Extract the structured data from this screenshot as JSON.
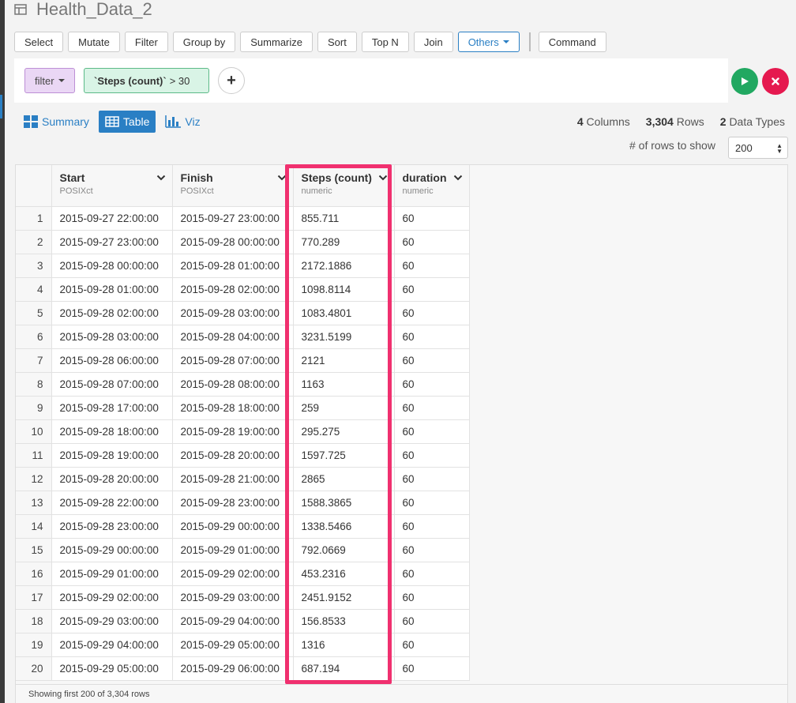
{
  "header": {
    "title": "Health_Data_2"
  },
  "toolbar": {
    "buttons": [
      "Select",
      "Mutate",
      "Filter",
      "Group by",
      "Summarize",
      "Sort",
      "Top N",
      "Join"
    ],
    "others_label": "Others",
    "command_label": "Command"
  },
  "filter": {
    "type_label": "filter",
    "expr_field": "`Steps (count)`",
    "expr_rest": "> 30"
  },
  "views": {
    "summary": "Summary",
    "table": "Table",
    "viz": "Viz"
  },
  "stats": {
    "columns_count": "4",
    "columns_label": "Columns",
    "rows_count": "3,304",
    "rows_label": "Rows",
    "types_count": "2",
    "types_label": "Data Types"
  },
  "rows_to_show": {
    "label": "# of rows to show",
    "value": "200"
  },
  "table": {
    "columns": [
      {
        "name": "Start",
        "type": "POSIXct"
      },
      {
        "name": "Finish",
        "type": "POSIXct"
      },
      {
        "name": "Steps (count)",
        "type": "numeric"
      },
      {
        "name": "duration",
        "type": "numeric"
      }
    ],
    "rows": [
      [
        "1",
        "2015-09-27 22:00:00",
        "2015-09-27 23:00:00",
        "855.711",
        "60"
      ],
      [
        "2",
        "2015-09-27 23:00:00",
        "2015-09-28 00:00:00",
        "770.289",
        "60"
      ],
      [
        "3",
        "2015-09-28 00:00:00",
        "2015-09-28 01:00:00",
        "2172.1886",
        "60"
      ],
      [
        "4",
        "2015-09-28 01:00:00",
        "2015-09-28 02:00:00",
        "1098.8114",
        "60"
      ],
      [
        "5",
        "2015-09-28 02:00:00",
        "2015-09-28 03:00:00",
        "1083.4801",
        "60"
      ],
      [
        "6",
        "2015-09-28 03:00:00",
        "2015-09-28 04:00:00",
        "3231.5199",
        "60"
      ],
      [
        "7",
        "2015-09-28 06:00:00",
        "2015-09-28 07:00:00",
        "2121",
        "60"
      ],
      [
        "8",
        "2015-09-28 07:00:00",
        "2015-09-28 08:00:00",
        "1163",
        "60"
      ],
      [
        "9",
        "2015-09-28 17:00:00",
        "2015-09-28 18:00:00",
        "259",
        "60"
      ],
      [
        "10",
        "2015-09-28 18:00:00",
        "2015-09-28 19:00:00",
        "295.275",
        "60"
      ],
      [
        "11",
        "2015-09-28 19:00:00",
        "2015-09-28 20:00:00",
        "1597.725",
        "60"
      ],
      [
        "12",
        "2015-09-28 20:00:00",
        "2015-09-28 21:00:00",
        "2865",
        "60"
      ],
      [
        "13",
        "2015-09-28 22:00:00",
        "2015-09-28 23:00:00",
        "1588.3865",
        "60"
      ],
      [
        "14",
        "2015-09-28 23:00:00",
        "2015-09-29 00:00:00",
        "1338.5466",
        "60"
      ],
      [
        "15",
        "2015-09-29 00:00:00",
        "2015-09-29 01:00:00",
        "792.0669",
        "60"
      ],
      [
        "16",
        "2015-09-29 01:00:00",
        "2015-09-29 02:00:00",
        "453.2316",
        "60"
      ],
      [
        "17",
        "2015-09-29 02:00:00",
        "2015-09-29 03:00:00",
        "2451.9152",
        "60"
      ],
      [
        "18",
        "2015-09-29 03:00:00",
        "2015-09-29 04:00:00",
        "156.8533",
        "60"
      ],
      [
        "19",
        "2015-09-29 04:00:00",
        "2015-09-29 05:00:00",
        "1316",
        "60"
      ],
      [
        "20",
        "2015-09-29 05:00:00",
        "2015-09-29 06:00:00",
        "687.194",
        "60"
      ]
    ]
  },
  "footer": {
    "text": "Showing first 200 of 3,304 rows"
  },
  "colors": {
    "accent": "#2a7fc4",
    "highlight": "#f0306f",
    "run": "#21a861",
    "clear": "#e5194f",
    "filter_type_bg": "#ead7f5",
    "filter_expr_bg": "#d9f4e6"
  }
}
